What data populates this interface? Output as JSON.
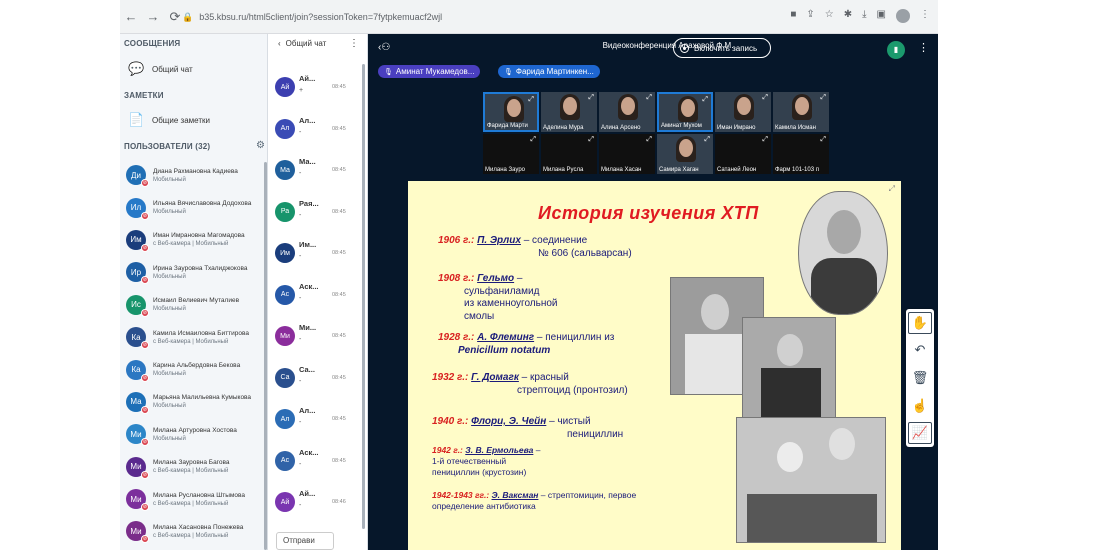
{
  "browser": {
    "url": "b35.kbsu.ru/html5client/join?sessionToken=7fytpkemuacf2wjl",
    "nav": {
      "back": "←",
      "forward": "→",
      "reload": "⟳"
    }
  },
  "sidebar": {
    "messages_heading": "СООБЩЕНИЯ",
    "public_chat": "Общий чат",
    "notes_heading": "ЗАМЕТКИ",
    "shared_notes": "Общие заметки",
    "users_heading": "ПОЛЬЗОВАТЕЛИ (32)",
    "users": [
      {
        "initials": "Ди",
        "name": "Диана Рахмановна Кадиева",
        "status": "Мобильный",
        "color": "#1f6fb5"
      },
      {
        "initials": "Ил",
        "name": "Ильяна Вячиславовна Додохова",
        "status": "Мобильный",
        "color": "#2679c8"
      },
      {
        "initials": "Им",
        "name": "Иман Имрановна Магомадова",
        "status": "с Веб-камера | Мобильный",
        "color": "#1a3d7c"
      },
      {
        "initials": "Ир",
        "name": "Ирина Зауровна Тхалиджокова",
        "status": "Мобильный",
        "color": "#1d5fa5"
      },
      {
        "initials": "Ис",
        "name": "Исмаил Велиевич Муталиев",
        "status": "Мобильный",
        "color": "#17946b"
      },
      {
        "initials": "Ка",
        "name": "Камила Исмаиловна Биттирова",
        "status": "с Веб-камера | Мобильный",
        "color": "#2a4f8e"
      },
      {
        "initials": "Ка",
        "name": "Карина Альбердовна Бекова",
        "status": "Мобильный",
        "color": "#2b77c2"
      },
      {
        "initials": "Ма",
        "name": "Марьяна Малильевна Кумыкова",
        "status": "Мобильный",
        "color": "#1c6fb7"
      },
      {
        "initials": "Ми",
        "name": "Милана Артуровна Хостова",
        "status": "Мобильный",
        "color": "#2c86c8"
      },
      {
        "initials": "Ми",
        "name": "Милана Зауровна Багова",
        "status": "с Веб-камера | Мобильный",
        "color": "#5a2a8e"
      },
      {
        "initials": "Ми",
        "name": "Милана Руслановна Штымова",
        "status": "с Веб-камера | Мобильный",
        "color": "#7b2f9c"
      },
      {
        "initials": "Ми",
        "name": "Милана Хасановна Понежева",
        "status": "с Веб-камера | Мобильный",
        "color": "#7a2d8a"
      }
    ]
  },
  "chat": {
    "title": "Общий чат",
    "messages": [
      {
        "initials": "Ай",
        "name": "Ай...",
        "time": "08:45",
        "text": "+",
        "color": "#3c3fb0"
      },
      {
        "initials": "Ал",
        "name": "Ал...",
        "time": "08:45",
        "text": "-",
        "color": "#3a4bb5"
      },
      {
        "initials": "Ма",
        "name": "Ма...",
        "time": "08:45",
        "text": "-",
        "color": "#1f5f9c"
      },
      {
        "initials": "Ра",
        "name": "Рая...",
        "time": "08:45",
        "text": "-",
        "color": "#17946b"
      },
      {
        "initials": "Им",
        "name": "Им...",
        "time": "08:45",
        "text": "-",
        "color": "#1a3d7c"
      },
      {
        "initials": "Ас",
        "name": "Аск...",
        "time": "08:45",
        "text": "-",
        "color": "#2558a8"
      },
      {
        "initials": "Ми",
        "name": "Ми...",
        "time": "08:45",
        "text": "-",
        "color": "#8b2d9c"
      },
      {
        "initials": "Са",
        "name": "Са...",
        "time": "08:45",
        "text": "-",
        "color": "#2a4f8e"
      },
      {
        "initials": "Ал",
        "name": "Ал...",
        "time": "08:45",
        "text": "-",
        "color": "#2b6cb5"
      },
      {
        "initials": "Ас",
        "name": "Аск...",
        "time": "08:45",
        "text": "-",
        "color": "#3063a8"
      },
      {
        "initials": "Ай",
        "name": "Ай...",
        "time": "08:46",
        "text": "-",
        "color": "#7a35b0"
      }
    ],
    "send_placeholder": "Отправи"
  },
  "meeting": {
    "title": "Видеоконференция Араховой Ф.М.",
    "record_label": "Включить запись",
    "talkers": [
      {
        "name": "Аминат Мукамедов...",
        "color": "#4a3fc0"
      },
      {
        "name": "Фарида Мартинкен...",
        "color": "#1e66d0"
      }
    ],
    "video_tiles": [
      {
        "name": "Фарида Марти",
        "active": true,
        "dark": false
      },
      {
        "name": "Аделина Мура",
        "active": false,
        "dark": false
      },
      {
        "name": "Алина Арсено",
        "active": false,
        "dark": false
      },
      {
        "name": "Аминат Мухом",
        "active": true,
        "dark": false
      },
      {
        "name": "Иман Имрано",
        "active": false,
        "dark": false
      },
      {
        "name": "Камила Исман",
        "active": false,
        "dark": false
      },
      {
        "name": "Милана Зауро",
        "active": false,
        "dark": true
      },
      {
        "name": "Милана Русла",
        "active": false,
        "dark": true
      },
      {
        "name": "Милана Хасан",
        "active": false,
        "dark": true
      },
      {
        "name": "Самира Хаган",
        "active": false,
        "dark": false
      },
      {
        "name": "Сатаней Леон",
        "active": false,
        "dark": true
      },
      {
        "name": "Фарм 101-103 п",
        "active": false,
        "dark": true
      }
    ],
    "slide": {
      "title": "История изучения ХТП",
      "entries": [
        {
          "year": "1906 г.:",
          "name": "П. Эрлих",
          "text": " – соединение",
          "text2": "№ 606 (сальварсан)"
        },
        {
          "year": "1908 г.:",
          "name": "Гельмо",
          "text": " –",
          "text2": "сульфаниламид",
          "text3": "из каменноугольной",
          "text4": "смолы"
        },
        {
          "year": "1928 г.:",
          "name": "А. Флеминг",
          "text": " – пенициллин из",
          "text2": "Penicillum notatum"
        },
        {
          "year": "1932 г.:",
          "name": "Г. Домагк",
          "text": " – красный",
          "text2": "стрептоцид (пронтозил)"
        },
        {
          "year": "1940 г.:",
          "name": "Флори, Э. Чейн",
          "text": " – чистый",
          "text2": "пенициллин"
        },
        {
          "year": "1942 г.:",
          "name": "З. В. Ермольева",
          "text": " –",
          "text2": "1-й отечественный",
          "text3": "пенициллин (крустозин)"
        },
        {
          "year": "1942-1943 гг.:",
          "name": "Э. Ваксман",
          "text": " – стрептомицин, первое",
          "text2": "определение антибиотика"
        }
      ]
    }
  },
  "toolbar": {
    "tools": [
      "hand-icon",
      "undo-icon",
      "trash-icon",
      "pointer-icon",
      "chart-icon"
    ]
  }
}
